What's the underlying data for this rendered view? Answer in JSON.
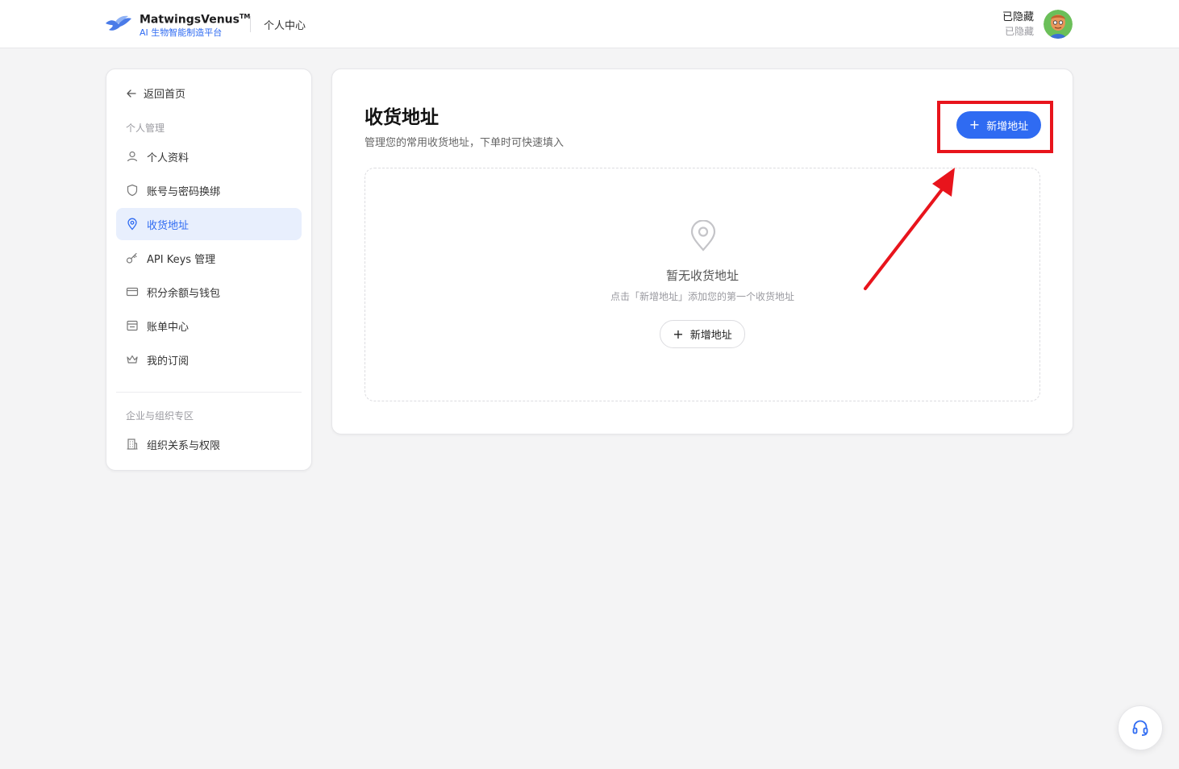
{
  "header": {
    "brand_name": "MatwingsVenus",
    "brand_tm": "TM",
    "brand_tagline": "AI 生物智能制造平台",
    "page_label": "个人中心",
    "user_name": "已隐藏",
    "user_sub": "已隐藏"
  },
  "sidebar": {
    "back_label": "返回首页",
    "section_personal": "个人管理",
    "items": [
      {
        "label": "个人资料",
        "icon": "user-icon"
      },
      {
        "label": "账号与密码换绑",
        "icon": "shield-icon"
      },
      {
        "label": "收货地址",
        "icon": "location-pin-icon",
        "active": true
      },
      {
        "label": "API Keys 管理",
        "icon": "key-icon"
      },
      {
        "label": "积分余额与钱包",
        "icon": "card-icon"
      },
      {
        "label": "账单中心",
        "icon": "bill-icon"
      },
      {
        "label": "我的订阅",
        "icon": "crown-icon"
      }
    ],
    "section_enterprise": "企业与组织专区",
    "enterprise_items": [
      {
        "label": "组织关系与权限",
        "icon": "building-icon"
      }
    ]
  },
  "main": {
    "title": "收货地址",
    "subtitle": "管理您的常用收货地址，下单时可快速填入",
    "add_button": "新增地址",
    "empty_title": "暂无收货地址",
    "empty_hint": "点击「新增地址」添加您的第一个收货地址",
    "empty_add_button": "新增地址"
  },
  "colors": {
    "accent": "#2f6bf2",
    "active_bg": "#e8effd",
    "annotation_red": "#e8141c",
    "page_bg": "#f4f4f5"
  }
}
